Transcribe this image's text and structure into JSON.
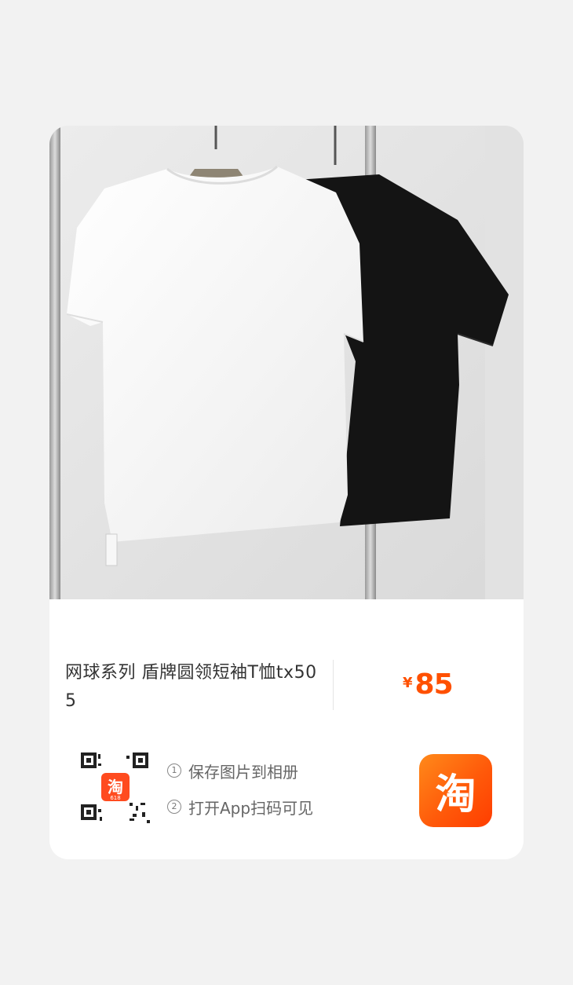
{
  "product": {
    "title": "网球系列 盾牌圆领短袖T恤tx505",
    "price_symbol": "¥",
    "price": "85",
    "image_icon": "product-photo-tshirts"
  },
  "share": {
    "qr_badge_text": "淘",
    "qr_badge_sub": "618",
    "step1_num": "①",
    "step1": "保存图片到相册",
    "step2_num": "②",
    "step2": "打开App扫码可见",
    "app_icon_glyph": "淘"
  },
  "colors": {
    "accent": "#ff5000",
    "card_bg": "#ffffff",
    "page_bg": "#f2f2f2"
  }
}
